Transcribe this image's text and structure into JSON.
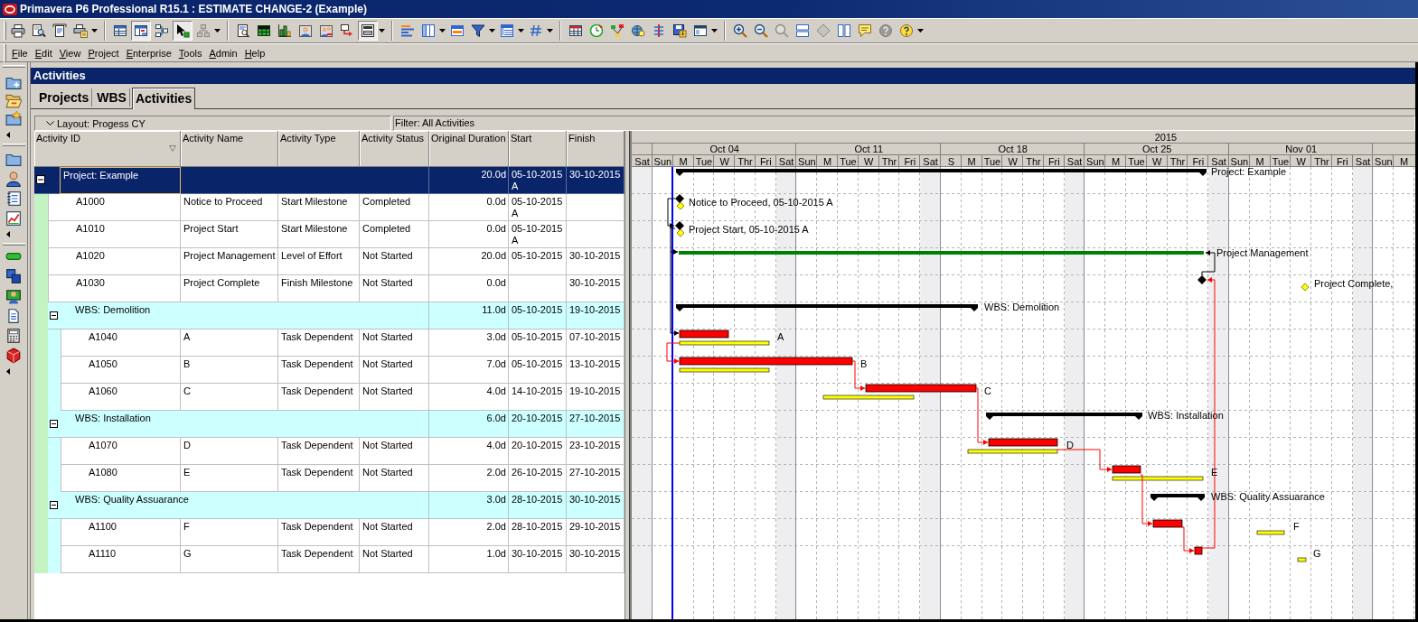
{
  "window": {
    "title": "Primavera P6 Professional R15.1 : ESTIMATE CHANGE-2 (Example)"
  },
  "toolbar": [
    {
      "pressed": false,
      "disabled": false
    },
    {
      "pressed": false,
      "disabled": false
    },
    {
      "pressed": false,
      "disabled": false
    },
    {
      "pressed": false,
      "disabled": false
    },
    {
      "pressed": false,
      "disabled": false
    },
    {
      "pressed": true,
      "disabled": false
    },
    {
      "pressed": false,
      "disabled": false
    },
    {
      "pressed": true,
      "disabled": false
    },
    {
      "pressed": false,
      "disabled": true
    },
    {
      "pressed": false,
      "disabled": false
    },
    {
      "pressed": false,
      "disabled": false
    },
    {
      "pressed": false,
      "disabled": false
    },
    {
      "pressed": false,
      "disabled": false
    },
    {
      "pressed": false,
      "disabled": false
    },
    {
      "pressed": false,
      "disabled": false
    },
    {
      "pressed": true,
      "disabled": false
    },
    {
      "pressed": false,
      "disabled": false
    },
    {
      "pressed": false,
      "disabled": false
    },
    {
      "pressed": false,
      "disabled": false
    },
    {
      "pressed": false,
      "disabled": false
    },
    {
      "pressed": false,
      "disabled": false
    },
    {
      "pressed": false,
      "disabled": false
    },
    {
      "pressed": false,
      "disabled": false
    },
    {
      "pressed": false,
      "disabled": false
    },
    {
      "pressed": false,
      "disabled": false
    },
    {
      "pressed": false,
      "disabled": false
    },
    {
      "pressed": false,
      "disabled": false
    },
    {
      "pressed": false,
      "disabled": false
    },
    {
      "pressed": false,
      "disabled": false
    },
    {
      "pressed": false,
      "disabled": false
    },
    {
      "pressed": false,
      "disabled": false
    },
    {
      "pressed": false,
      "disabled": true
    },
    {
      "pressed": false,
      "disabled": false
    },
    {
      "pressed": false,
      "disabled": true
    },
    {
      "pressed": false,
      "disabled": false
    },
    {
      "pressed": false,
      "disabled": false
    },
    {
      "pressed": false,
      "disabled": true
    },
    {
      "pressed": false,
      "disabled": false
    }
  ],
  "menu": [
    "File",
    "Edit",
    "View",
    "Project",
    "Enterprise",
    "Tools",
    "Admin",
    "Help"
  ],
  "panel": {
    "title": "Activities"
  },
  "tabs": [
    {
      "label": "Projects",
      "selected": false
    },
    {
      "label": "WBS",
      "selected": false
    },
    {
      "label": "Activities",
      "selected": true
    }
  ],
  "layout_bar": {
    "layout": "Layout: Progess CY",
    "filter": "Filter: All Activities"
  },
  "table": {
    "columns": [
      {
        "label": "Activity ID",
        "sorted": true
      },
      {
        "label": "Activity Name",
        "sorted": false
      },
      {
        "label": "Activity Type",
        "sorted": false
      },
      {
        "label": "Activity Status",
        "sorted": false
      },
      {
        "label": "Original Duration",
        "sorted": false
      },
      {
        "label": "Start",
        "sorted": false
      },
      {
        "label": "Finish",
        "sorted": false
      }
    ],
    "rows": [
      {
        "kind": "project",
        "title": "Project: Example",
        "duration": "20.0d",
        "start": "05-10-2015 A",
        "finish": "30-10-2015",
        "selected": true,
        "expanded": true,
        "children": [
          {
            "kind": "activity",
            "id": "A1000",
            "name": "Notice to Proceed",
            "type": "Start Milestone",
            "status": "Completed",
            "duration": "0.0d",
            "start": "05-10-2015 A",
            "selected": false
          },
          {
            "kind": "activity",
            "id": "A1010",
            "name": "Project Start",
            "type": "Start Milestone",
            "status": "Completed",
            "duration": "0.0d",
            "start": "05-10-2015 A",
            "selected": false
          },
          {
            "kind": "activity",
            "id": "A1020",
            "name": "Project Management",
            "type": "Level of Effort",
            "status": "Not Started",
            "duration": "20.0d",
            "start": "05-10-2015",
            "finish": "30-10-2015",
            "selected": false
          },
          {
            "kind": "activity",
            "id": "A1030",
            "name": "Project Complete",
            "type": "Finish Milestone",
            "status": "Not Started",
            "duration": "0.0d",
            "finish": "30-10-2015",
            "selected": false
          },
          {
            "kind": "wbs",
            "title": "WBS: Demolition",
            "duration": "11.0d",
            "start": "05-10-2015",
            "finish": "19-10-2015",
            "selected": false,
            "expanded": true,
            "children": [
              {
                "kind": "activity",
                "id": "A1040",
                "name": "A",
                "type": "Task Dependent",
                "status": "Not Started",
                "duration": "3.0d",
                "start": "05-10-2015",
                "finish": "07-10-2015",
                "selected": false
              },
              {
                "kind": "activity",
                "id": "A1050",
                "name": "B",
                "type": "Task Dependent",
                "status": "Not Started",
                "duration": "7.0d",
                "start": "05-10-2015",
                "finish": "13-10-2015",
                "selected": false
              },
              {
                "kind": "activity",
                "id": "A1060",
                "name": "C",
                "type": "Task Dependent",
                "status": "Not Started",
                "duration": "4.0d",
                "start": "14-10-2015",
                "finish": "19-10-2015",
                "selected": false
              }
            ]
          },
          {
            "kind": "wbs",
            "title": "WBS: Installation",
            "duration": "6.0d",
            "start": "20-10-2015",
            "finish": "27-10-2015",
            "selected": false,
            "expanded": true,
            "children": [
              {
                "kind": "activity",
                "id": "A1070",
                "name": "D",
                "type": "Task Dependent",
                "status": "Not Started",
                "duration": "4.0d",
                "start": "20-10-2015",
                "finish": "23-10-2015",
                "selected": false
              },
              {
                "kind": "activity",
                "id": "A1080",
                "name": "E",
                "type": "Task Dependent",
                "status": "Not Started",
                "duration": "2.0d",
                "start": "26-10-2015",
                "finish": "27-10-2015",
                "selected": false
              }
            ]
          },
          {
            "kind": "wbs",
            "title": "WBS: Quality Assuarance",
            "duration": "3.0d",
            "start": "28-10-2015",
            "finish": "30-10-2015",
            "selected": false,
            "expanded": true,
            "children": [
              {
                "kind": "activity",
                "id": "A1100",
                "name": "F",
                "type": "Task Dependent",
                "status": "Not Started",
                "duration": "2.0d",
                "start": "28-10-2015",
                "finish": "29-10-2015",
                "selected": false
              },
              {
                "kind": "activity",
                "id": "A1110",
                "name": "G",
                "type": "Task Dependent",
                "status": "Not Started",
                "duration": "1.0d",
                "start": "30-10-2015",
                "finish": "30-10-2015",
                "selected": false
              }
            ]
          }
        ]
      }
    ]
  },
  "gantt": {
    "year": "2015",
    "weeks": [
      "Oct 04",
      "Oct 11",
      "Oct 18",
      "Oct 25",
      "Nov 01"
    ],
    "days": [
      {
        "label": "Sat",
        "nonwork": true
      },
      {
        "label": "Sun",
        "nonwork": false
      },
      {
        "label": "M",
        "nonwork": false
      },
      {
        "label": "Tue",
        "nonwork": false
      },
      {
        "label": "W",
        "nonwork": false
      },
      {
        "label": "Thr",
        "nonwork": false
      },
      {
        "label": "Fri",
        "nonwork": false
      },
      {
        "label": "Sat",
        "nonwork": true
      },
      {
        "label": "Sun",
        "nonwork": false
      },
      {
        "label": "M",
        "nonwork": false
      },
      {
        "label": "Tue",
        "nonwork": false
      },
      {
        "label": "W",
        "nonwork": false
      },
      {
        "label": "Thr",
        "nonwork": false
      },
      {
        "label": "Fri",
        "nonwork": false
      },
      {
        "label": "Sat",
        "nonwork": true
      },
      {
        "label": "S",
        "nonwork": false
      },
      {
        "label": "M",
        "nonwork": false
      },
      {
        "label": "Tue",
        "nonwork": false
      },
      {
        "label": "W",
        "nonwork": false
      },
      {
        "label": "Thr",
        "nonwork": false
      },
      {
        "label": "Fri",
        "nonwork": false
      },
      {
        "label": "Sat",
        "nonwork": true
      },
      {
        "label": "Sun",
        "nonwork": false
      },
      {
        "label": "M",
        "nonwork": false
      },
      {
        "label": "Tue",
        "nonwork": false
      },
      {
        "label": "W",
        "nonwork": false
      },
      {
        "label": "Thr",
        "nonwork": false
      },
      {
        "label": "Fri",
        "nonwork": false
      },
      {
        "label": "Sat",
        "nonwork": true
      },
      {
        "label": "Sun",
        "nonwork": false
      },
      {
        "label": "M",
        "nonwork": false
      },
      {
        "label": "Tue",
        "nonwork": false
      },
      {
        "label": "W",
        "nonwork": false
      },
      {
        "label": "Thr",
        "nonwork": false
      },
      {
        "label": "Fri",
        "nonwork": false
      },
      {
        "label": "Sat",
        "nonwork": true
      },
      {
        "label": "Sun",
        "nonwork": false
      },
      {
        "label": "M",
        "nonwork": false
      }
    ],
    "bars": [
      {
        "kind": "summary",
        "label": "Project: Example"
      },
      {
        "kind": "milestone",
        "label": "Notice to Proceed, 05-10-2015 A"
      },
      {
        "kind": "milestone",
        "label": "Project Start, 05-10-2015 A"
      },
      {
        "kind": "effort",
        "label": "Project Management"
      },
      {
        "kind": "milestone",
        "label": "Project Complete,"
      },
      {
        "kind": "summary",
        "label": "WBS: Demolition"
      },
      {
        "kind": "task",
        "label": "A"
      },
      {
        "kind": "task",
        "label": "B"
      },
      {
        "kind": "task",
        "label": "C"
      },
      {
        "kind": "summary",
        "label": "WBS: Installation"
      },
      {
        "kind": "task",
        "label": "D"
      },
      {
        "kind": "task",
        "label": "E"
      },
      {
        "kind": "summary",
        "label": "WBS: Quality Assuarance"
      },
      {
        "kind": "task",
        "label": "F"
      },
      {
        "kind": "task",
        "label": "G"
      }
    ]
  }
}
